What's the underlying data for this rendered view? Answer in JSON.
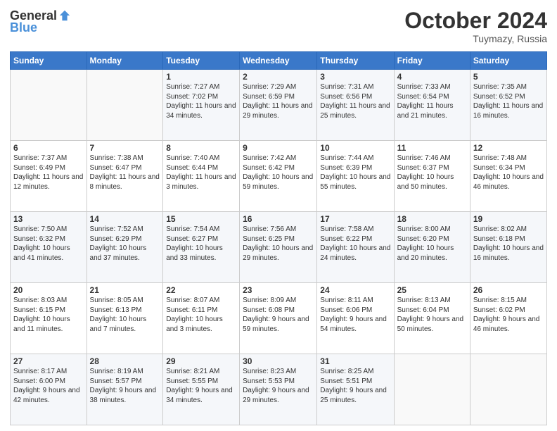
{
  "logo": {
    "general": "General",
    "blue": "Blue"
  },
  "title": "October 2024",
  "location": "Tuymazy, Russia",
  "header_days": [
    "Sunday",
    "Monday",
    "Tuesday",
    "Wednesday",
    "Thursday",
    "Friday",
    "Saturday"
  ],
  "weeks": [
    [
      {
        "day": "",
        "sunrise": "",
        "sunset": "",
        "daylight": ""
      },
      {
        "day": "",
        "sunrise": "",
        "sunset": "",
        "daylight": ""
      },
      {
        "day": "1",
        "sunrise": "Sunrise: 7:27 AM",
        "sunset": "Sunset: 7:02 PM",
        "daylight": "Daylight: 11 hours and 34 minutes."
      },
      {
        "day": "2",
        "sunrise": "Sunrise: 7:29 AM",
        "sunset": "Sunset: 6:59 PM",
        "daylight": "Daylight: 11 hours and 29 minutes."
      },
      {
        "day": "3",
        "sunrise": "Sunrise: 7:31 AM",
        "sunset": "Sunset: 6:56 PM",
        "daylight": "Daylight: 11 hours and 25 minutes."
      },
      {
        "day": "4",
        "sunrise": "Sunrise: 7:33 AM",
        "sunset": "Sunset: 6:54 PM",
        "daylight": "Daylight: 11 hours and 21 minutes."
      },
      {
        "day": "5",
        "sunrise": "Sunrise: 7:35 AM",
        "sunset": "Sunset: 6:52 PM",
        "daylight": "Daylight: 11 hours and 16 minutes."
      }
    ],
    [
      {
        "day": "6",
        "sunrise": "Sunrise: 7:37 AM",
        "sunset": "Sunset: 6:49 PM",
        "daylight": "Daylight: 11 hours and 12 minutes."
      },
      {
        "day": "7",
        "sunrise": "Sunrise: 7:38 AM",
        "sunset": "Sunset: 6:47 PM",
        "daylight": "Daylight: 11 hours and 8 minutes."
      },
      {
        "day": "8",
        "sunrise": "Sunrise: 7:40 AM",
        "sunset": "Sunset: 6:44 PM",
        "daylight": "Daylight: 11 hours and 3 minutes."
      },
      {
        "day": "9",
        "sunrise": "Sunrise: 7:42 AM",
        "sunset": "Sunset: 6:42 PM",
        "daylight": "Daylight: 10 hours and 59 minutes."
      },
      {
        "day": "10",
        "sunrise": "Sunrise: 7:44 AM",
        "sunset": "Sunset: 6:39 PM",
        "daylight": "Daylight: 10 hours and 55 minutes."
      },
      {
        "day": "11",
        "sunrise": "Sunrise: 7:46 AM",
        "sunset": "Sunset: 6:37 PM",
        "daylight": "Daylight: 10 hours and 50 minutes."
      },
      {
        "day": "12",
        "sunrise": "Sunrise: 7:48 AM",
        "sunset": "Sunset: 6:34 PM",
        "daylight": "Daylight: 10 hours and 46 minutes."
      }
    ],
    [
      {
        "day": "13",
        "sunrise": "Sunrise: 7:50 AM",
        "sunset": "Sunset: 6:32 PM",
        "daylight": "Daylight: 10 hours and 41 minutes."
      },
      {
        "day": "14",
        "sunrise": "Sunrise: 7:52 AM",
        "sunset": "Sunset: 6:29 PM",
        "daylight": "Daylight: 10 hours and 37 minutes."
      },
      {
        "day": "15",
        "sunrise": "Sunrise: 7:54 AM",
        "sunset": "Sunset: 6:27 PM",
        "daylight": "Daylight: 10 hours and 33 minutes."
      },
      {
        "day": "16",
        "sunrise": "Sunrise: 7:56 AM",
        "sunset": "Sunset: 6:25 PM",
        "daylight": "Daylight: 10 hours and 29 minutes."
      },
      {
        "day": "17",
        "sunrise": "Sunrise: 7:58 AM",
        "sunset": "Sunset: 6:22 PM",
        "daylight": "Daylight: 10 hours and 24 minutes."
      },
      {
        "day": "18",
        "sunrise": "Sunrise: 8:00 AM",
        "sunset": "Sunset: 6:20 PM",
        "daylight": "Daylight: 10 hours and 20 minutes."
      },
      {
        "day": "19",
        "sunrise": "Sunrise: 8:02 AM",
        "sunset": "Sunset: 6:18 PM",
        "daylight": "Daylight: 10 hours and 16 minutes."
      }
    ],
    [
      {
        "day": "20",
        "sunrise": "Sunrise: 8:03 AM",
        "sunset": "Sunset: 6:15 PM",
        "daylight": "Daylight: 10 hours and 11 minutes."
      },
      {
        "day": "21",
        "sunrise": "Sunrise: 8:05 AM",
        "sunset": "Sunset: 6:13 PM",
        "daylight": "Daylight: 10 hours and 7 minutes."
      },
      {
        "day": "22",
        "sunrise": "Sunrise: 8:07 AM",
        "sunset": "Sunset: 6:11 PM",
        "daylight": "Daylight: 10 hours and 3 minutes."
      },
      {
        "day": "23",
        "sunrise": "Sunrise: 8:09 AM",
        "sunset": "Sunset: 6:08 PM",
        "daylight": "Daylight: 9 hours and 59 minutes."
      },
      {
        "day": "24",
        "sunrise": "Sunrise: 8:11 AM",
        "sunset": "Sunset: 6:06 PM",
        "daylight": "Daylight: 9 hours and 54 minutes."
      },
      {
        "day": "25",
        "sunrise": "Sunrise: 8:13 AM",
        "sunset": "Sunset: 6:04 PM",
        "daylight": "Daylight: 9 hours and 50 minutes."
      },
      {
        "day": "26",
        "sunrise": "Sunrise: 8:15 AM",
        "sunset": "Sunset: 6:02 PM",
        "daylight": "Daylight: 9 hours and 46 minutes."
      }
    ],
    [
      {
        "day": "27",
        "sunrise": "Sunrise: 8:17 AM",
        "sunset": "Sunset: 6:00 PM",
        "daylight": "Daylight: 9 hours and 42 minutes."
      },
      {
        "day": "28",
        "sunrise": "Sunrise: 8:19 AM",
        "sunset": "Sunset: 5:57 PM",
        "daylight": "Daylight: 9 hours and 38 minutes."
      },
      {
        "day": "29",
        "sunrise": "Sunrise: 8:21 AM",
        "sunset": "Sunset: 5:55 PM",
        "daylight": "Daylight: 9 hours and 34 minutes."
      },
      {
        "day": "30",
        "sunrise": "Sunrise: 8:23 AM",
        "sunset": "Sunset: 5:53 PM",
        "daylight": "Daylight: 9 hours and 29 minutes."
      },
      {
        "day": "31",
        "sunrise": "Sunrise: 8:25 AM",
        "sunset": "Sunset: 5:51 PM",
        "daylight": "Daylight: 9 hours and 25 minutes."
      },
      {
        "day": "",
        "sunrise": "",
        "sunset": "",
        "daylight": ""
      },
      {
        "day": "",
        "sunrise": "",
        "sunset": "",
        "daylight": ""
      }
    ]
  ]
}
